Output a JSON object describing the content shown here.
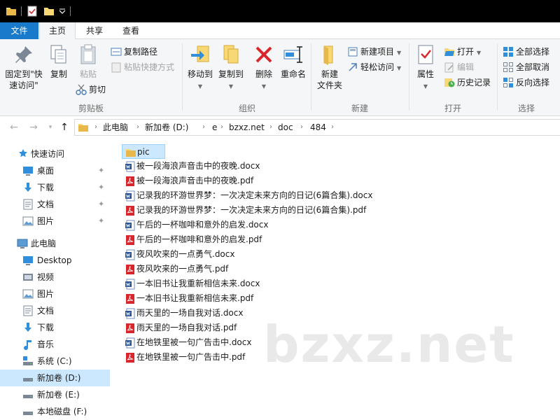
{
  "tabs": {
    "file": "文件",
    "home": "主页",
    "share": "共享",
    "view": "查看"
  },
  "ribbon": {
    "clipboard": {
      "label": "剪贴板",
      "pin_line1": "固定到\"快",
      "pin_line2": "速访问\"",
      "copy": "复制",
      "paste": "粘贴",
      "copy_path": "复制路径",
      "paste_shortcut": "粘贴快捷方式",
      "cut": "剪切"
    },
    "organize": {
      "label": "组织",
      "move_to": "移动到",
      "copy_to": "复制到",
      "delete": "删除",
      "rename": "重命名"
    },
    "new": {
      "label": "新建",
      "new_folder_line1": "新建",
      "new_folder_line2": "文件夹",
      "new_item": "新建项目",
      "easy_access": "轻松访问"
    },
    "open": {
      "label": "打开",
      "properties": "属性",
      "open": "打开",
      "edit": "编辑",
      "history": "历史记录"
    },
    "select": {
      "label": "选择",
      "select_all": "全部选择",
      "select_none": "全部取消",
      "invert": "反向选择"
    }
  },
  "address": {
    "crumbs": [
      "此电脑",
      "新加卷 (D:)",
      "e",
      "bzxz.net",
      "doc",
      "484"
    ]
  },
  "nav": {
    "quick_access": "快速访问",
    "qa_items": [
      "桌面",
      "下载",
      "文档",
      "图片"
    ],
    "this_pc": "此电脑",
    "pc_items": [
      "Desktop",
      "视频",
      "图片",
      "文档",
      "下载",
      "音乐",
      "系统 (C:)",
      "新加卷 (D:)",
      "新加卷 (E:)",
      "本地磁盘 (F:)"
    ]
  },
  "files": [
    {
      "name": "pic",
      "type": "folder"
    },
    {
      "name": "被一段海浪声音击中的夜晚.docx",
      "type": "docx"
    },
    {
      "name": "被一段海浪声音击中的夜晚.pdf",
      "type": "pdf"
    },
    {
      "name": "记录我的环游世界梦：一次决定未来方向的日记(6篇合集).docx",
      "type": "docx"
    },
    {
      "name": "记录我的环游世界梦：一次决定未来方向的日记(6篇合集).pdf",
      "type": "pdf"
    },
    {
      "name": "午后的一杯咖啡和意外的启发.docx",
      "type": "docx"
    },
    {
      "name": "午后的一杯咖啡和意外的启发.pdf",
      "type": "pdf"
    },
    {
      "name": "夜风吹来的一点勇气.docx",
      "type": "docx"
    },
    {
      "name": "夜风吹来的一点勇气.pdf",
      "type": "pdf"
    },
    {
      "name": "一本旧书让我重新相信未来.docx",
      "type": "docx"
    },
    {
      "name": "一本旧书让我重新相信未来.pdf",
      "type": "pdf"
    },
    {
      "name": "雨天里的一场自我对话.docx",
      "type": "docx"
    },
    {
      "name": "雨天里的一场自我对话.pdf",
      "type": "pdf"
    },
    {
      "name": "在地铁里被一句广告击中.docx",
      "type": "docx"
    },
    {
      "name": "在地铁里被一句广告击中.pdf",
      "type": "pdf"
    }
  ],
  "watermark": "bzxz.net",
  "colors": {
    "accent": "#1979ca",
    "selection": "#cce8ff",
    "folder": "#f8d775",
    "pdf_red": "#d9262c",
    "word_blue": "#2b579a"
  }
}
